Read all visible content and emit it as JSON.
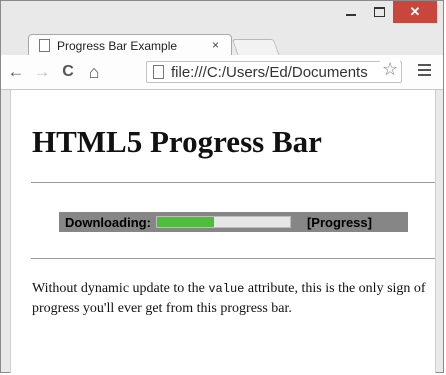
{
  "window": {
    "close_glyph": "✕"
  },
  "tab": {
    "title": "Progress Bar Example",
    "close_glyph": "×"
  },
  "toolbar": {
    "back_glyph": "←",
    "forward_glyph": "→",
    "reload_glyph": "C",
    "home_glyph": "⌂",
    "url": "file:///C:/Users/Ed/Documents",
    "star_glyph": "☆"
  },
  "page": {
    "heading": "HTML5 Progress Bar",
    "progress_label": "Downloading:",
    "progress_value": 0.43,
    "progress_fill_color": "#4fbd3c",
    "progress_after_label": "[Progress]",
    "para_before": "Without dynamic update to the ",
    "para_code": "value",
    "para_after": " attribute, this is the only sign of progress you'll ever get from this progress bar."
  }
}
